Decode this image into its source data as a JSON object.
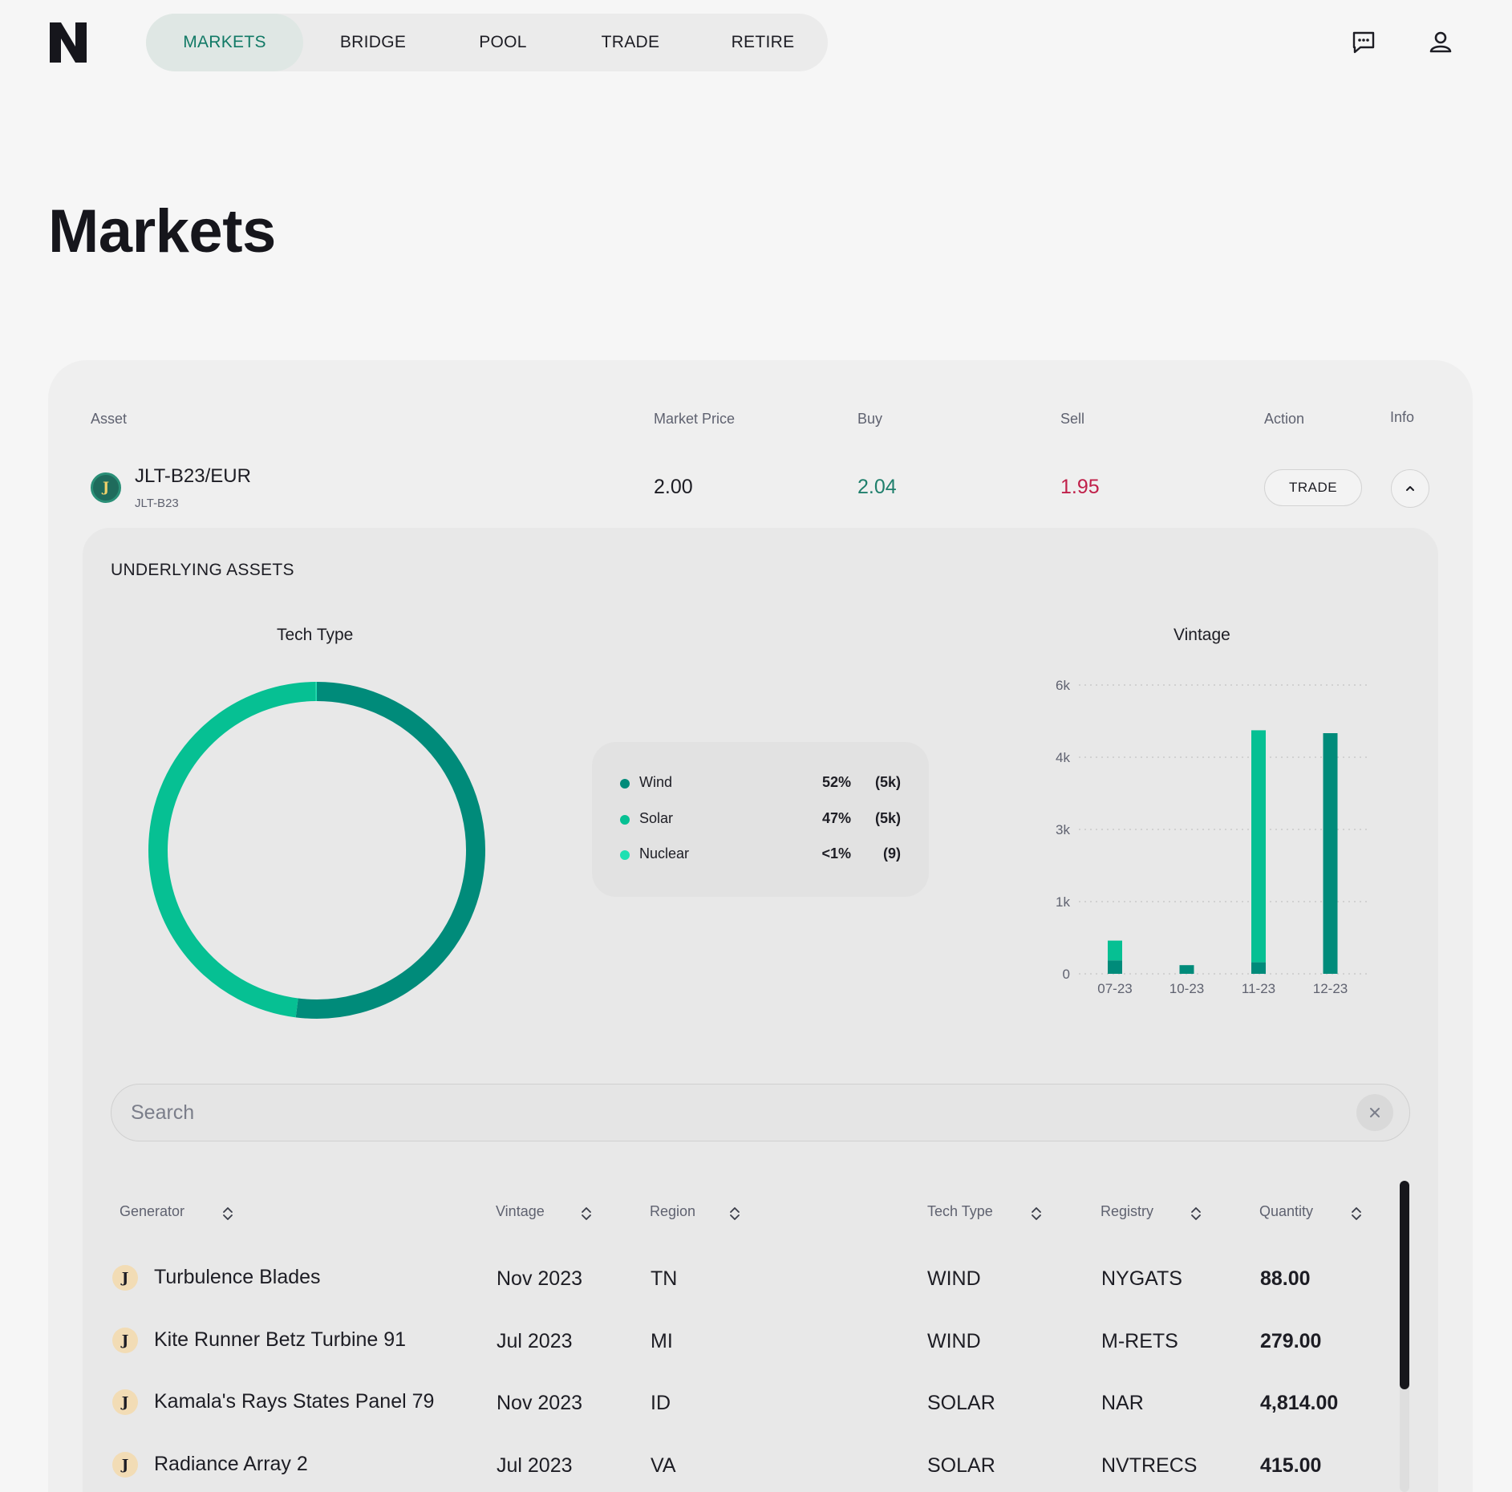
{
  "nav": {
    "items": [
      {
        "label": "MARKETS",
        "active": true
      },
      {
        "label": "BRIDGE",
        "active": false
      },
      {
        "label": "POOL",
        "active": false
      },
      {
        "label": "TRADE",
        "active": false
      },
      {
        "label": "RETIRE",
        "active": false
      }
    ],
    "icons": [
      "chat-icon",
      "user-icon"
    ]
  },
  "page": {
    "title": "Markets"
  },
  "market_table": {
    "headers": {
      "asset": "Asset",
      "market_price": "Market Price",
      "buy": "Buy",
      "sell": "Sell",
      "action": "Action",
      "info": "Info"
    },
    "row": {
      "asset_logo": "J",
      "asset_name": "JLT-B23/EUR",
      "asset_symbol": "JLT-B23",
      "market_price": "2.00",
      "buy": "2.04",
      "sell": "1.95",
      "action_label": "TRADE"
    }
  },
  "underlying": {
    "title": "UNDERLYING ASSETS",
    "tech_type_title": "Tech Type",
    "vintage_title": "Vintage",
    "legend": [
      {
        "name": "Wind",
        "pct": "52%",
        "count": "(5k)",
        "color": "#008b7a"
      },
      {
        "name": "Solar",
        "pct": "47%",
        "count": "(5k)",
        "color": "#06c093"
      },
      {
        "name": "Nuclear",
        "pct": "<1%",
        "count": "(9)",
        "color": "#1ee0b2"
      }
    ]
  },
  "chart_data": [
    {
      "type": "pie",
      "title": "Tech Type",
      "categories": [
        "Wind",
        "Solar",
        "Nuclear"
      ],
      "values": [
        52,
        47.9,
        0.1
      ],
      "colors": [
        "#008b7a",
        "#06c093",
        "#1ee0b2"
      ],
      "donut": true
    },
    {
      "type": "bar",
      "title": "Vintage",
      "stacked": true,
      "categories": [
        "07-23",
        "10-23",
        "11-23",
        "12-23"
      ],
      "series": [
        {
          "values": [
            280,
            180,
            240,
            5000
          ],
          "color": "#008b7a"
        },
        {
          "values": [
            410,
            0,
            4820,
            0
          ],
          "color": "#06c093"
        }
      ],
      "yticks": [
        0,
        1500,
        3000,
        4500,
        6000
      ],
      "ytick_labels": [
        "0",
        "1k",
        "3k",
        "4k",
        "6k"
      ],
      "ylim": [
        0,
        6000
      ],
      "grid": true
    }
  ],
  "search": {
    "placeholder": "Search"
  },
  "generators": {
    "headers": [
      "Generator",
      "Vintage",
      "Region",
      "Tech Type",
      "Registry",
      "Quantity"
    ],
    "rows": [
      {
        "logo": "J",
        "generator": "Turbulence Blades",
        "vintage": "Nov 2023",
        "region": "TN",
        "tech": "WIND",
        "registry": "NYGATS",
        "quantity": "88.00"
      },
      {
        "logo": "J",
        "generator": "Kite Runner Betz Turbine 91",
        "vintage": "Jul 2023",
        "region": "MI",
        "tech": "WIND",
        "registry": "M-RETS",
        "quantity": "279.00"
      },
      {
        "logo": "J",
        "generator": "Kamala's Rays States Panel 79",
        "vintage": "Nov 2023",
        "region": "ID",
        "tech": "SOLAR",
        "registry": "NAR",
        "quantity": "4,814.00"
      },
      {
        "logo": "J",
        "generator": "Radiance Array 2",
        "vintage": "Jul 2023",
        "region": "VA",
        "tech": "SOLAR",
        "registry": "NVTRECS",
        "quantity": "415.00"
      }
    ]
  },
  "colors": {
    "accent": "#127a66",
    "buy": "#1f7f6c",
    "sell": "#c0204a"
  }
}
